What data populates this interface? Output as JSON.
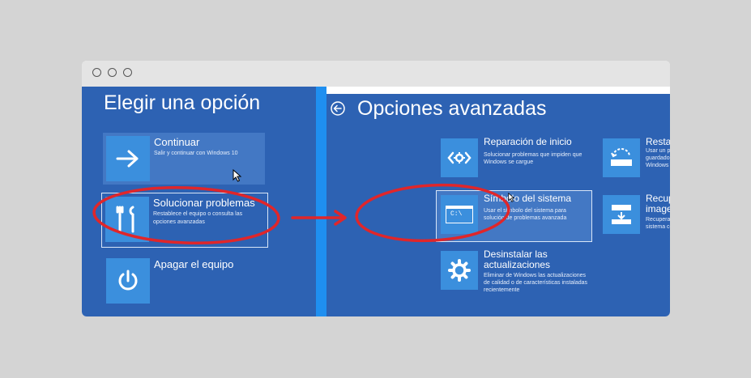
{
  "window": {
    "controls": [
      "close-circle",
      "minimize-circle",
      "maximize-circle"
    ]
  },
  "left_screen": {
    "title": "Elegir una opción",
    "options": [
      {
        "title": "Continuar",
        "description": "Salir y continuar con Windows 10",
        "icon": "arrow-right-icon"
      },
      {
        "title": "Solucionar problemas",
        "description": "Restablece el equipo o consulta las opciones avanzadas",
        "icon": "tools-icon"
      },
      {
        "title": "Apagar el equipo",
        "description": "",
        "icon": "power-icon"
      }
    ]
  },
  "right_screen": {
    "title": "Opciones avanzadas",
    "back_icon": "back-arrow-icon",
    "options": [
      {
        "title": "Reparación de inicio",
        "description": "Solucionar problemas que impiden que Windows se cargue",
        "icon": "startup-repair-icon"
      },
      {
        "title": "Restaurar sistema",
        "description": "Usar un punto de restauración guardado en el equipo para restaurar Windows",
        "icon": "restore-icon"
      },
      {
        "title": "Símbolo del sistema",
        "description": "Usar el símbolo del sistema para solución de problemas avanzada",
        "icon": "command-prompt-icon",
        "icon_text": "C:\\"
      },
      {
        "title": "Recuperación de imagen del sistema",
        "title_lines": [
          "Recuperación de",
          "imagen del sistema"
        ],
        "description": "Recuperar Windows con una imagen de sistema concreta",
        "icon": "image-recovery-icon"
      },
      {
        "title": "Desinstalar las actualizaciones",
        "title_lines": [
          "Desinstalar las",
          "actualizaciones"
        ],
        "description": "Eliminar de Windows las actualizaciones de calidad o de características instaladas recientemente",
        "icon": "gear-icon"
      }
    ]
  },
  "annotations": {
    "circle_color": "#e0262a",
    "arrow_color": "#e0262a"
  },
  "colors": {
    "background": "#d4d4d4",
    "panel_blue": "#2d62b3",
    "tile_icon_blue": "#3b8fdd",
    "accent_strip": "#1f8ff0"
  }
}
